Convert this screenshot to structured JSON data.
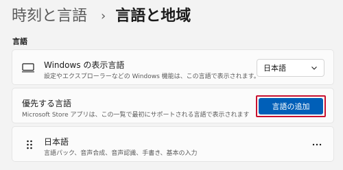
{
  "breadcrumb": {
    "parent": "時刻と言語",
    "separator": "›",
    "current": "言語と地域"
  },
  "section_label": "言語",
  "display_language": {
    "title": "Windows の表示言語",
    "subtitle": "設定やエクスプローラーなどの Windows 機能は、この言語で表示されます。",
    "selected_value": "日本語"
  },
  "preferred_languages": {
    "title": "優先する言語",
    "subtitle": "Microsoft Store アプリは、この一覧で最初にサポートされる言語で表示されます",
    "add_button_label": "言語の追加"
  },
  "language_item": {
    "name": "日本語",
    "features": "言語パック、音声合成、音声認識、手書き、基本の入力"
  },
  "icons": {
    "display": "monitor-icon",
    "dropdown": "chevron-down-icon",
    "reorder": "drag-handle-icon",
    "more": "more-options-icon"
  },
  "colors": {
    "accent": "#005fb8",
    "highlight_outline": "#c8102e",
    "background": "#f3f3f3",
    "card": "#fbfbfb"
  }
}
